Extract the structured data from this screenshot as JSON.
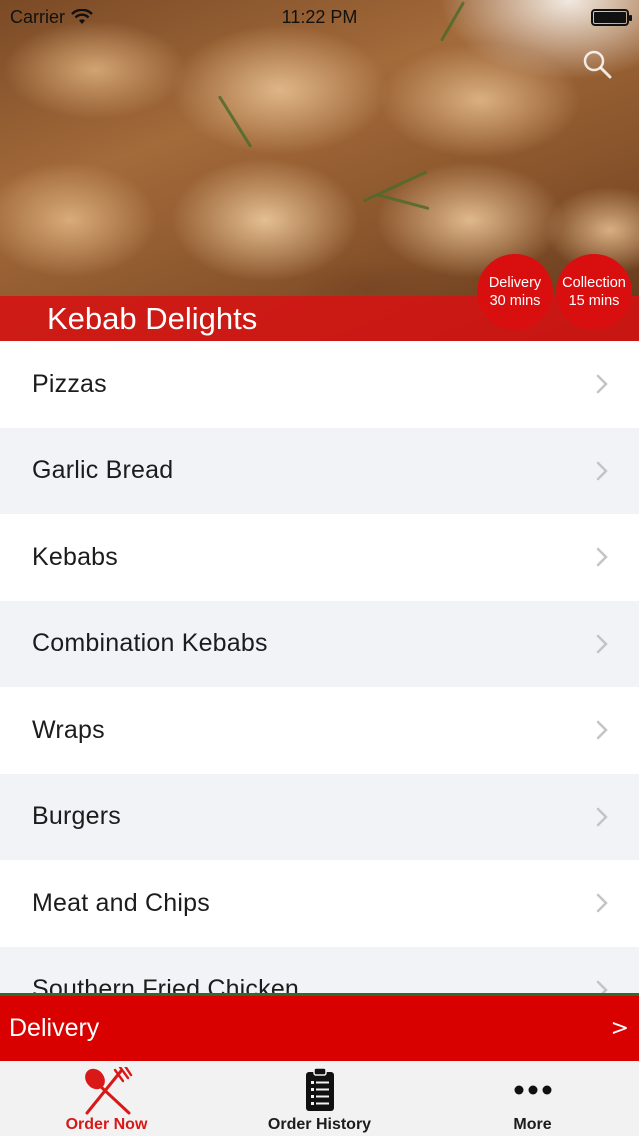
{
  "status_bar": {
    "carrier": "Carrier",
    "time": "11:22 PM",
    "battery_level": 1.0
  },
  "hero": {
    "store_name": "Kebab Delights",
    "delivery": {
      "label": "Delivery",
      "time": "30 mins"
    },
    "collection": {
      "label": "Collection",
      "time": "15 mins"
    },
    "search_icon": "search-icon"
  },
  "menu": {
    "categories": [
      {
        "label": "Pizzas"
      },
      {
        "label": "Garlic Bread"
      },
      {
        "label": "Kebabs"
      },
      {
        "label": "Combination Kebabs"
      },
      {
        "label": "Wraps"
      },
      {
        "label": "Burgers"
      },
      {
        "label": "Meat and Chips"
      },
      {
        "label": "Southern Fried Chicken"
      }
    ],
    "chevron_icon": "chevron-right-icon"
  },
  "order_bar": {
    "label": "Delivery",
    "arrow": ">"
  },
  "tabs": [
    {
      "label": "Order Now",
      "icon": "fork-spoon-icon",
      "active": true
    },
    {
      "label": "Order History",
      "icon": "clipboard-icon",
      "active": false
    },
    {
      "label": "More",
      "icon": "more-dots-icon",
      "active": false
    }
  ],
  "colors": {
    "brand_red": "#d90000",
    "active_tab": "#d91818",
    "row_alt": "#f1f3f6"
  }
}
